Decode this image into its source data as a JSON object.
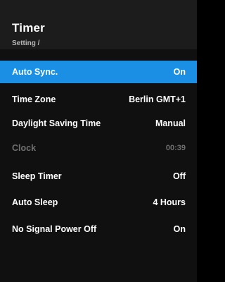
{
  "header": {
    "title": "Timer",
    "breadcrumb": "Setting /"
  },
  "colors": {
    "accent": "#1a8fe3",
    "background": "#000000",
    "header_bg": "#1c1c1c",
    "panel_bg": "#101010",
    "disabled_text": "#707070"
  },
  "menu": {
    "items": [
      {
        "label": "Auto Sync.",
        "value": "On"
      },
      {
        "label": "Time Zone",
        "value": "Berlin GMT+1"
      },
      {
        "label": "Daylight Saving Time",
        "value": "Manual"
      },
      {
        "label": "Clock",
        "value": "00:39"
      },
      {
        "label": "Sleep Timer",
        "value": "Off"
      },
      {
        "label": "Auto Sleep",
        "value": "4 Hours"
      },
      {
        "label": "No Signal Power Off",
        "value": "On"
      }
    ]
  }
}
